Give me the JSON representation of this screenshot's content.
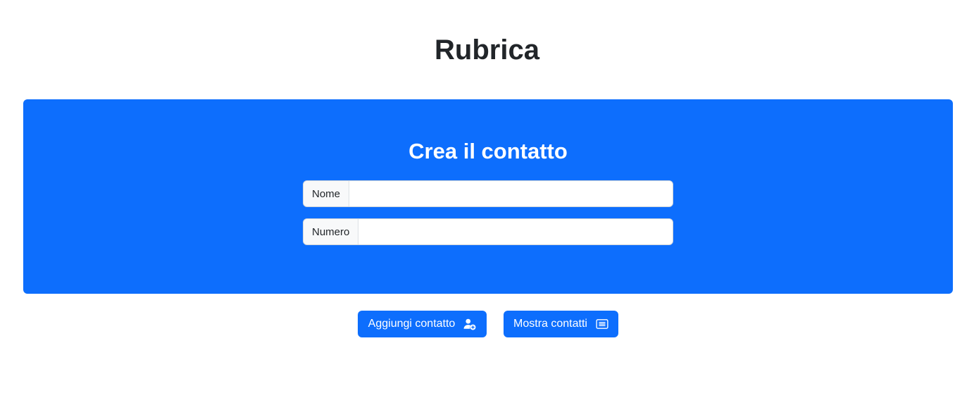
{
  "page": {
    "title": "Rubrica"
  },
  "form": {
    "title": "Crea il contatto",
    "fields": [
      {
        "label": "Nome",
        "value": "",
        "placeholder": ""
      },
      {
        "label": "Numero",
        "value": "",
        "placeholder": ""
      }
    ]
  },
  "actions": {
    "add_label": "Aggiungi contatto",
    "add_icon": "person-add-icon",
    "show_label": "Mostra contatti",
    "show_icon": "list-card-icon"
  },
  "colors": {
    "primary": "#0d6efd",
    "text": "#212529",
    "background": "#ffffff"
  }
}
